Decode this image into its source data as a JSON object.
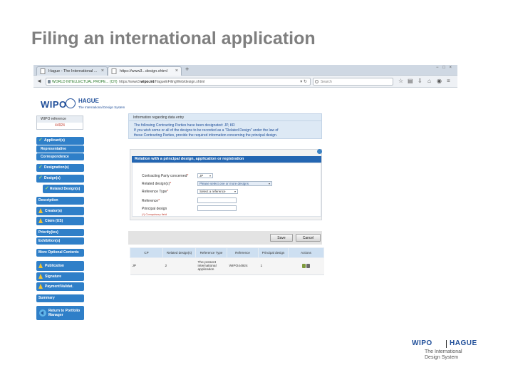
{
  "slide": {
    "title": "Filing an international application"
  },
  "browser": {
    "tabs": [
      {
        "label": "Hague - The International ..."
      },
      {
        "label": "https://www3...design.xhtml"
      }
    ],
    "new_tab": "+",
    "window_controls": "− □ ×",
    "url_org": "WORLD INTELLECTUAL PROPE... (CH)",
    "url_domain_prefix": "https://www3.",
    "url_domain": "wipo.int",
    "url_path": "/HagueEFilingWeb/design.xhtml",
    "search_placeholder": "Search"
  },
  "app": {
    "logo_wipo": "WIPO",
    "logo_hague": "HAGUE",
    "logo_sub": "The International Design System"
  },
  "sidebar": {
    "ref_label": "WIPO reference",
    "ref_value": "44924",
    "items": [
      {
        "label": "Applicant(s)",
        "mark": "check"
      },
      {
        "label": "Representative",
        "mark": ""
      },
      {
        "label": "Correspondence",
        "mark": ""
      },
      {
        "label": "Designation(s)",
        "mark": "check"
      },
      {
        "label": "Design(s)",
        "mark": "check"
      },
      {
        "label": "Related Design(s)",
        "mark": "check"
      },
      {
        "label": "Description",
        "mark": ""
      },
      {
        "label": "Creator(s)",
        "mark": "warning"
      },
      {
        "label": "Claim (US)",
        "mark": "warning"
      },
      {
        "label": "Priority(ies)",
        "mark": ""
      },
      {
        "label": "Exhibition(s)",
        "mark": ""
      },
      {
        "label": "More Optional Contents",
        "mark": ""
      },
      {
        "label": "Publication",
        "mark": "warning"
      },
      {
        "label": "Signature",
        "mark": "warning"
      },
      {
        "label": "Payment/Validat.",
        "mark": "warning"
      },
      {
        "label": "Summary",
        "mark": ""
      },
      {
        "label": "Return to Portfolio Manager",
        "mark": ""
      }
    ]
  },
  "info": {
    "title": "Information regarding data entry",
    "line1": "The following Contracting Parties have been designated: JP, KR",
    "line2": "If you wish some or all of the designs to be recorded as a \"Related Design\" under the law of",
    "line3": "these Contracting Parties, provide the required information concerning the principal design."
  },
  "relation": {
    "header": "Relation with a principal design, application or registration",
    "contracting_party_label": "Contracting Party concerned",
    "contracting_party_value": "JP",
    "related_designs_label": "Related design(s)",
    "related_designs_value": "Please select one or more designs",
    "reference_type_label": "Reference Type",
    "reference_type_value": "Select a reference",
    "reference_label": "Reference",
    "principal_design_label": "Principal design",
    "compulsory_note": "(*) Compulsory field",
    "required_mark": "*"
  },
  "actions": {
    "save": "Save",
    "cancel": "Cancel"
  },
  "table": {
    "headers": [
      "CP",
      "Related design(s)",
      "Reference Type",
      "Reference",
      "Principal design",
      "Actions"
    ],
    "rows": [
      [
        "JP",
        "2",
        "The present international application",
        "WIPO44924",
        "1"
      ]
    ]
  },
  "footer": {
    "wipo": "WIPO",
    "hague": "HAGUE",
    "sub1": "The International",
    "sub2": "Design System"
  },
  "colors": {
    "accent": "#2f7fc8",
    "header_blue": "#2466b2",
    "brand": "#1f4e99",
    "error": "#c0392b"
  }
}
